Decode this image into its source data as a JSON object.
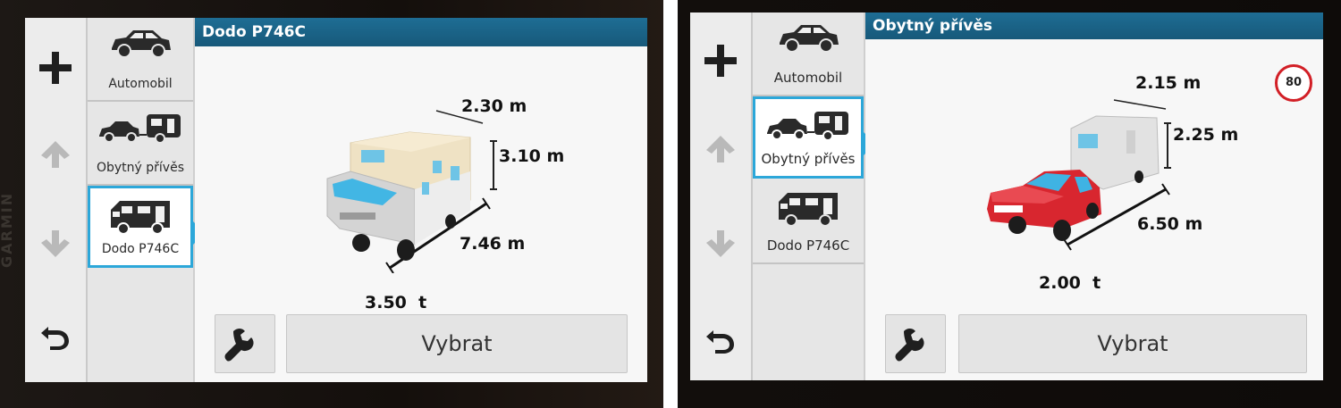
{
  "screens": [
    {
      "title": "Dodo P746C",
      "vehicles": [
        {
          "label": "Automobil",
          "icon": "car-icon"
        },
        {
          "label": "Obytný přívěs",
          "icon": "car-caravan-icon"
        },
        {
          "label": "Dodo P746C",
          "icon": "motorhome-icon"
        }
      ],
      "selected_vehicle": "Dodo P746C",
      "width": "2.30 m",
      "height": "3.10 m",
      "length": "7.46 m",
      "weight": "3.50  t",
      "select_label": "Vybrat",
      "bezel_brand": "GARMIN"
    },
    {
      "title": "Obytný přívěs",
      "vehicles": [
        {
          "label": "Automobil",
          "icon": "car-icon"
        },
        {
          "label": "Obytný přívěs",
          "icon": "car-caravan-icon"
        },
        {
          "label": "Dodo P746C",
          "icon": "motorhome-icon"
        }
      ],
      "selected_vehicle": "Obytný přívěs",
      "width": "2.15 m",
      "height": "2.25 m",
      "length": "6.50 m",
      "weight": "2.00  t",
      "speed_limit": "80",
      "select_label": "Vybrat"
    }
  ],
  "colors": {
    "accent": "#2ca7d9",
    "titlebar": "#1a6489",
    "speed_ring": "#d21f26",
    "car_red": "#d8262f"
  }
}
